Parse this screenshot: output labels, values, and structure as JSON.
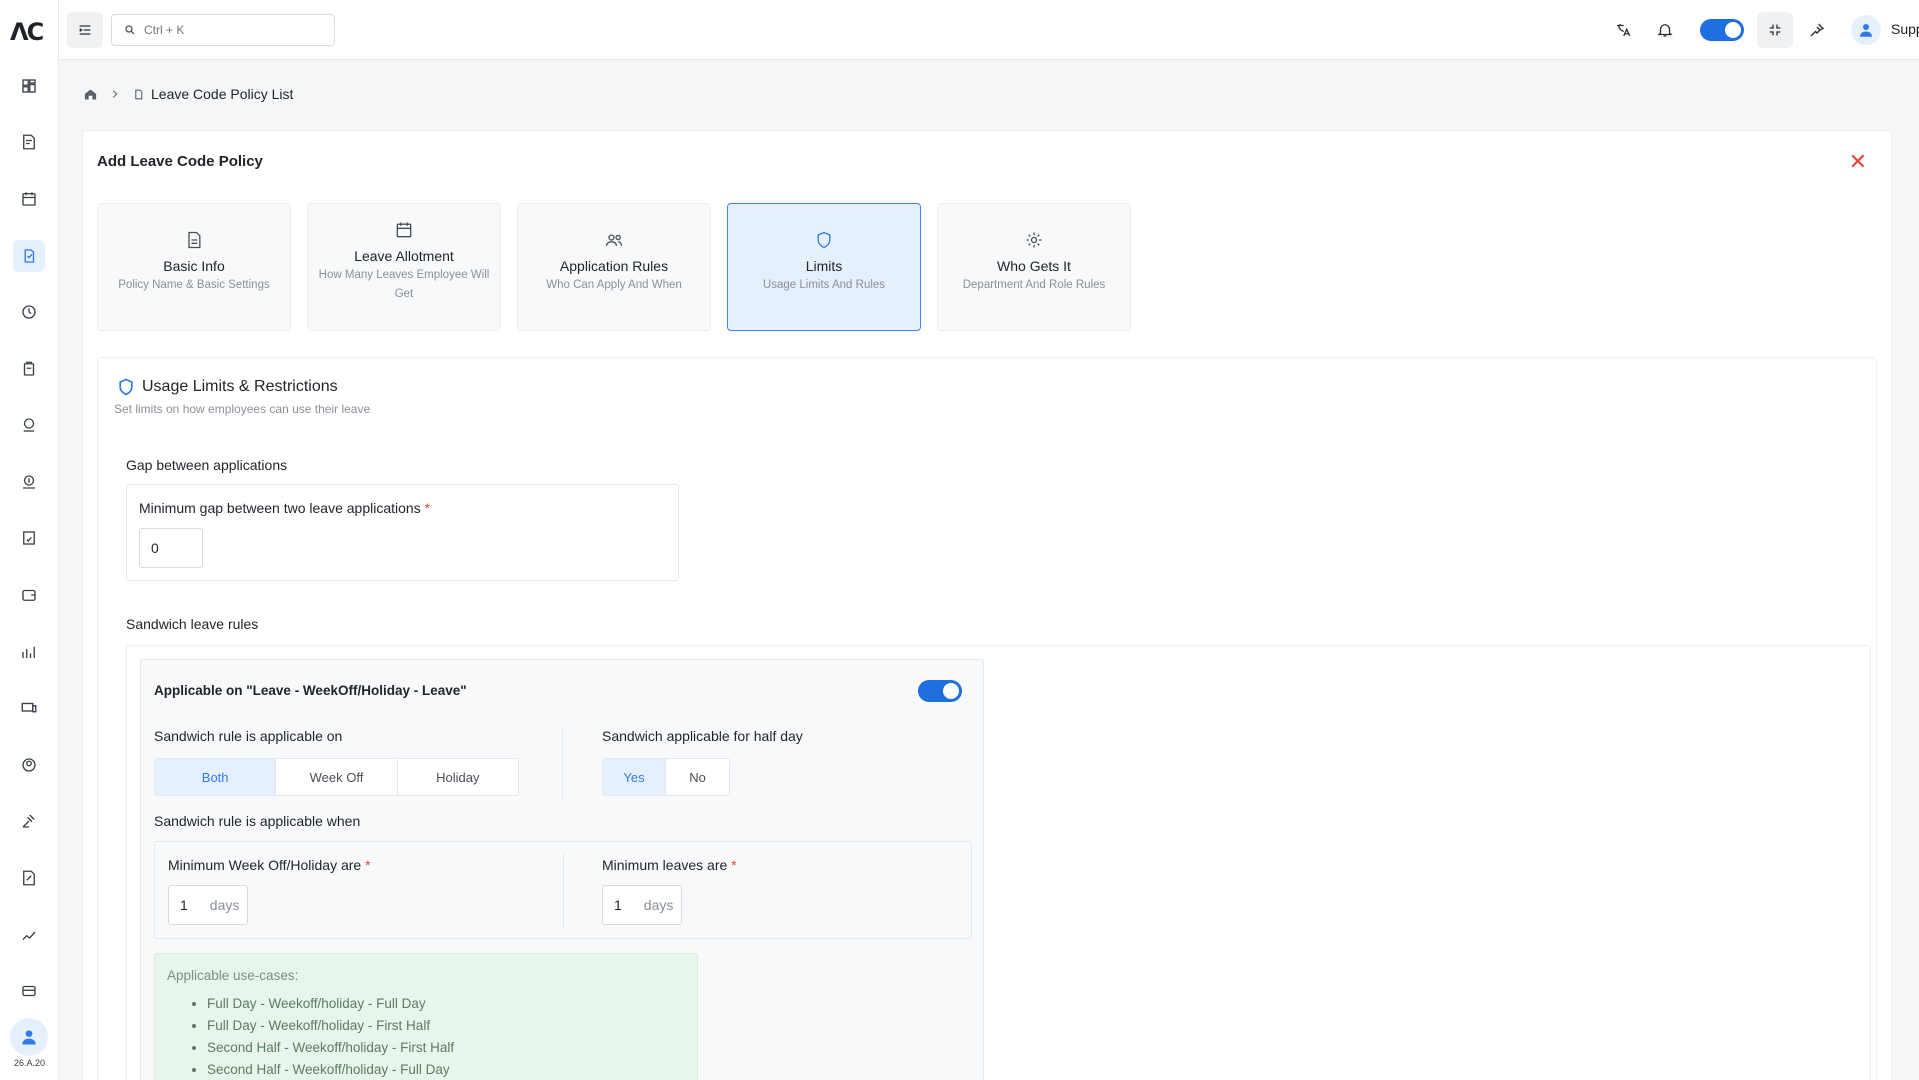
{
  "app": {
    "logo": "ΛC",
    "version": "26.A.20"
  },
  "topbar": {
    "search_placeholder": "Ctrl + K",
    "user_name": "Support"
  },
  "breadcrumb": {
    "current": "Leave Code Policy List"
  },
  "card": {
    "title": "Add Leave Code Policy"
  },
  "steps": [
    {
      "title": "Basic Info",
      "subtitle": "Policy Name & Basic Settings",
      "icon": "document-icon",
      "active": false
    },
    {
      "title": "Leave Allotment",
      "subtitle": "How Many Leaves Employee Will Get",
      "icon": "calendar-icon",
      "active": false
    },
    {
      "title": "Application Rules",
      "subtitle": "Who Can Apply And When",
      "icon": "users-icon",
      "active": false
    },
    {
      "title": "Limits",
      "subtitle": "Usage Limits And Rules",
      "icon": "shield-icon",
      "active": true
    },
    {
      "title": "Who Gets It",
      "subtitle": "Department And Role Rules",
      "icon": "gear-icon",
      "active": false
    }
  ],
  "section": {
    "title": "Usage Limits & Restrictions",
    "subtitle": "Set limits on how employees can use their leave",
    "gap": {
      "heading": "Gap between applications",
      "label": "Minimum gap between two leave applications",
      "required": "*",
      "value": "0"
    },
    "sandwich": {
      "heading": "Sandwich leave rules",
      "applicable_label": "Applicable on \"Leave - WeekOff/Holiday - Leave\"",
      "applicable_enabled": true,
      "rule_on_label": "Sandwich rule is applicable on",
      "rule_on_options": [
        "Both",
        "Week Off",
        "Holiday"
      ],
      "rule_on_selected": "Both",
      "half_day_label": "Sandwich applicable for half day",
      "half_day_options": [
        "Yes",
        "No"
      ],
      "half_day_selected": "Yes",
      "when_label": "Sandwich rule is applicable when",
      "min_weekoff_label": "Minimum Week Off/Holiday are",
      "min_weekoff_value": "1",
      "min_leaves_label": "Minimum leaves are",
      "min_leaves_value": "1",
      "unit": "days",
      "usecases_title": "Applicable use-cases:",
      "usecases": [
        "Full Day - Weekoff/holiday - Full Day",
        "Full Day - Weekoff/holiday - First Half",
        "Second Half - Weekoff/holiday - First Half",
        "Second Half - Weekoff/holiday - Full Day"
      ]
    }
  },
  "colors": {
    "accent": "#2f7be5",
    "toggle": "#1f6fe0",
    "danger": "#e0473c",
    "usecase_bg": "#e8f5ea"
  }
}
